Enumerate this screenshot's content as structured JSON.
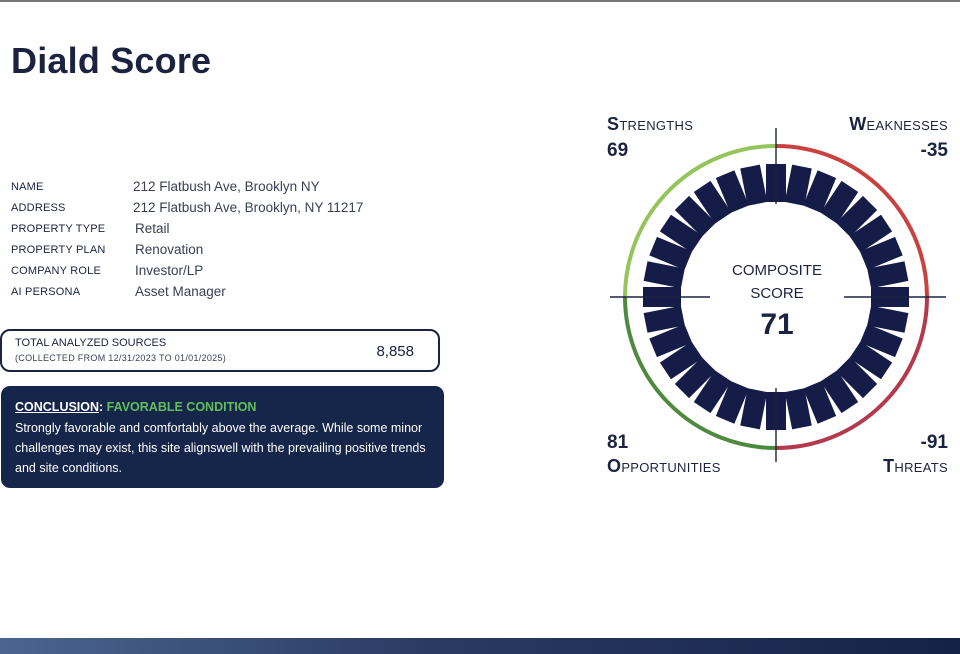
{
  "page": {
    "title": "Diald Score"
  },
  "property": {
    "rows": [
      {
        "label": "NAME",
        "value": "212 Flatbush Ave, Brooklyn NY"
      },
      {
        "label": "ADDRESS",
        "value": "212 Flatbush Ave, Brooklyn, NY 11217"
      },
      {
        "label": "PROPERTY TYPE",
        "value": "Retail"
      },
      {
        "label": "PROPERTY PLAN",
        "value": "Renovation"
      },
      {
        "label": "COMPANY ROLE",
        "value": "Investor/LP"
      },
      {
        "label": "AI PERSONA",
        "value": "Asset Manager"
      }
    ]
  },
  "sources": {
    "title": "TOTAL ANALYZED SOURCES",
    "range": "(COLLECTED  FROM  12/31/2023  TO  01/01/2025)",
    "count": "8,858"
  },
  "conclusion": {
    "label": "CONCLUSION",
    "separator": ": ",
    "status": "FAVORABLE CONDITION",
    "text": "Strongly favorable and comfortably above the average. While some minor challenges may exist, this site alignswell with the prevailing positive trends and site conditions."
  },
  "gauge": {
    "center_line1": "COMPOSITE",
    "center_line2": "SCORE",
    "composite": "71",
    "strengths": {
      "cap": "S",
      "rest": "TRENGTHS",
      "value": "69"
    },
    "weaknesses": {
      "cap": "W",
      "rest": "EAKNESSES",
      "value": "-35"
    },
    "opportunities": {
      "cap": "O",
      "rest": "PPORTUNITIES",
      "value": "81"
    },
    "threats": {
      "cap": "T",
      "rest": "HREATS",
      "value": "-91"
    },
    "colors": {
      "strengths": "#94c45a",
      "weaknesses": "#c9423f",
      "opportunities": "#4d8a3e",
      "threats": "#b4394c",
      "segments": "#141c47",
      "axes": "#1b2340"
    }
  }
}
